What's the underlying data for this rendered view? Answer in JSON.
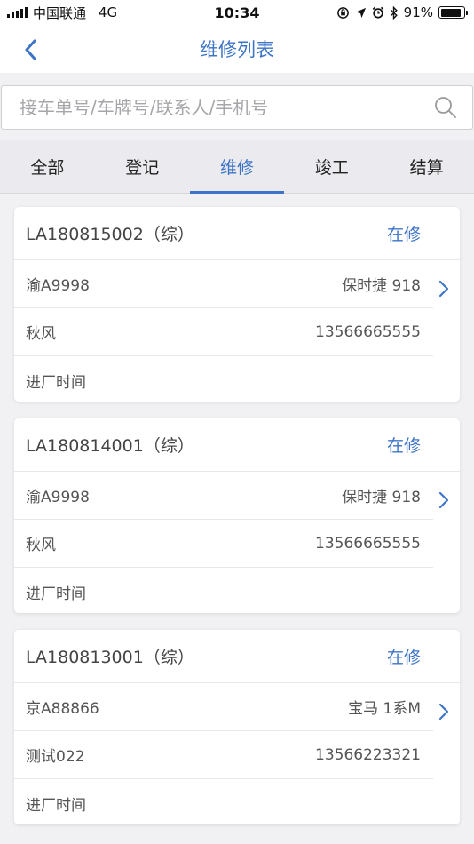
{
  "status_bar": {
    "carrier": "中国联通",
    "network": "4G",
    "time": "10:34",
    "battery": "91%",
    "battery_level": 0.91
  },
  "nav": {
    "title": "维修列表"
  },
  "search": {
    "placeholder": "接车单号/车牌号/联系人/手机号",
    "value": ""
  },
  "tabs": [
    {
      "label": "全部",
      "active": false
    },
    {
      "label": "登记",
      "active": false
    },
    {
      "label": "维修",
      "active": true
    },
    {
      "label": "竣工",
      "active": false
    },
    {
      "label": "结算",
      "active": false
    }
  ],
  "orders": [
    {
      "order_no": "LA180815002（综）",
      "status": "在修",
      "plate": "渝A9998",
      "car": "保时捷 918",
      "contact": "秋风",
      "phone": "13566665555",
      "entry_label": "进厂时间"
    },
    {
      "order_no": "LA180814001（综）",
      "status": "在修",
      "plate": "渝A9998",
      "car": "保时捷 918",
      "contact": "秋风",
      "phone": "13566665555",
      "entry_label": "进厂时间"
    },
    {
      "order_no": "LA180813001（综）",
      "status": "在修",
      "plate": "京A88866",
      "car": "宝马 1系M",
      "contact": "测试022",
      "phone": "13566223321",
      "entry_label": "进厂时间"
    }
  ],
  "colors": {
    "accent": "#3d74c7",
    "background": "#f1f1f3"
  }
}
